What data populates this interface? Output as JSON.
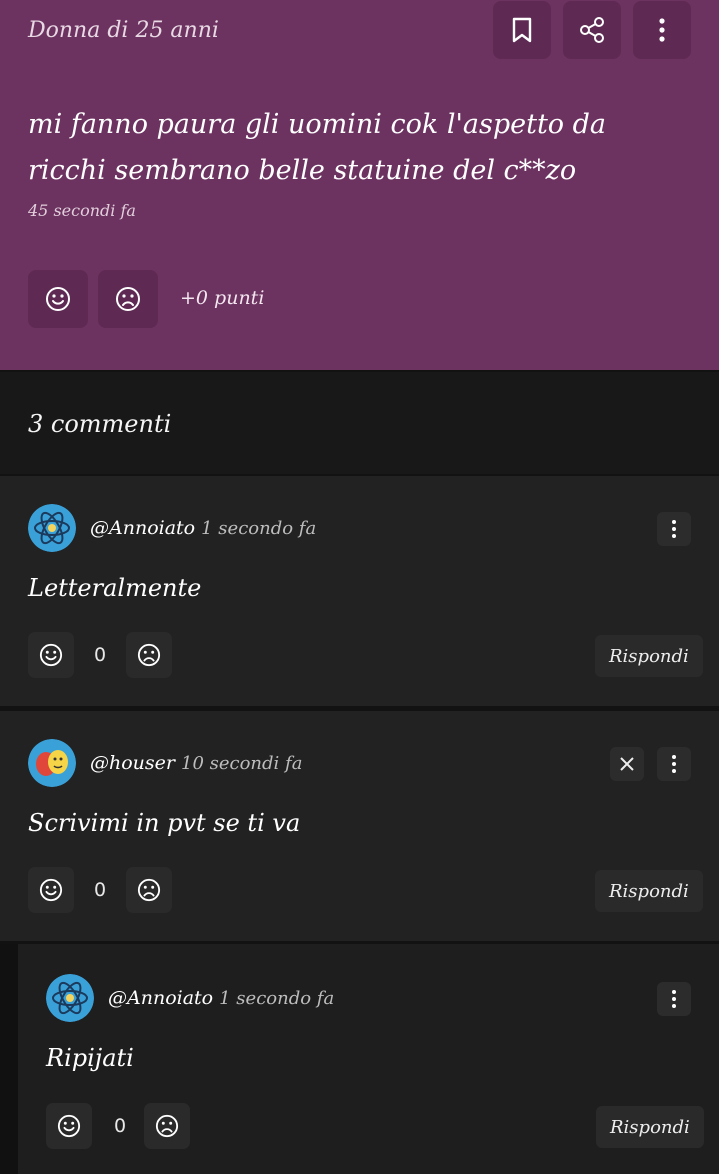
{
  "post": {
    "author": "Donna di 25 anni",
    "text": "mi fanno paura gli uomini cok l'aspetto da ricchi sembrano belle statuine del c**zo",
    "time": "45 secondi fa",
    "points": "+0 punti",
    "icons": [
      "bookmark-icon",
      "share-icon",
      "more-vertical-icon",
      "smile-icon",
      "frown-icon"
    ]
  },
  "comments_header": {
    "count_label": "3 commenti"
  },
  "comments": [
    {
      "user": "@Annoiato",
      "time": "1 secondo fa",
      "text": "Letteralmente",
      "score": "0",
      "reply_label": "Rispondi",
      "avatar": "atom-avatar"
    },
    {
      "user": "@houser",
      "time": "10 secondi fa",
      "text": "Scrivimi in pvt se ti va",
      "score": "0",
      "reply_label": "Rispondi",
      "avatar": "theater-masks-avatar"
    },
    {
      "user": "@Annoiato",
      "time": "1 secondo fa",
      "text": "Ripijati",
      "score": "0",
      "reply_label": "Rispondi",
      "avatar": "atom-avatar"
    }
  ],
  "colors": {
    "post_bg": "#6c3260",
    "card_bg": "#222222",
    "page_bg": "#121212"
  }
}
